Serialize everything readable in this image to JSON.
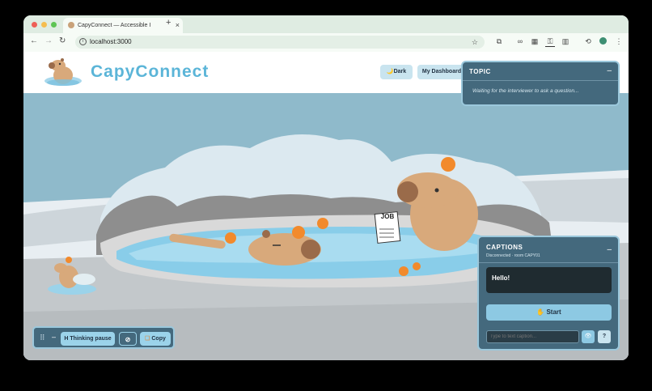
{
  "browser": {
    "tab_title": "CapyConnect — Accessible I",
    "tab_close": "×",
    "new_tab": "+",
    "url": "localhost:3000",
    "back": "←",
    "forward": "→",
    "reload": "↻"
  },
  "header": {
    "logo_text": "CapyConnect",
    "dark_button": "🌙Dark",
    "dashboard_button": "My Dashboard"
  },
  "topic_panel": {
    "title": "TOPIC",
    "minimize": "–",
    "message": "Waiting for the interviewer to ask a question..."
  },
  "captions_panel": {
    "title": "CAPTIONS",
    "status": "Disconnected · room CAPY01",
    "minimize": "–",
    "caption_text": "Hello!",
    "start_button": "✋ Start",
    "input_placeholder": "Type to text caption...",
    "eye_icon": "👁",
    "help_button": "?"
  },
  "bottom_bar": {
    "drag_handle": "⠿",
    "minimize": "–",
    "thinking_button": "H Thinking pause",
    "copy_button": "Copy"
  },
  "scene": {
    "sign_text": "JOB"
  }
}
